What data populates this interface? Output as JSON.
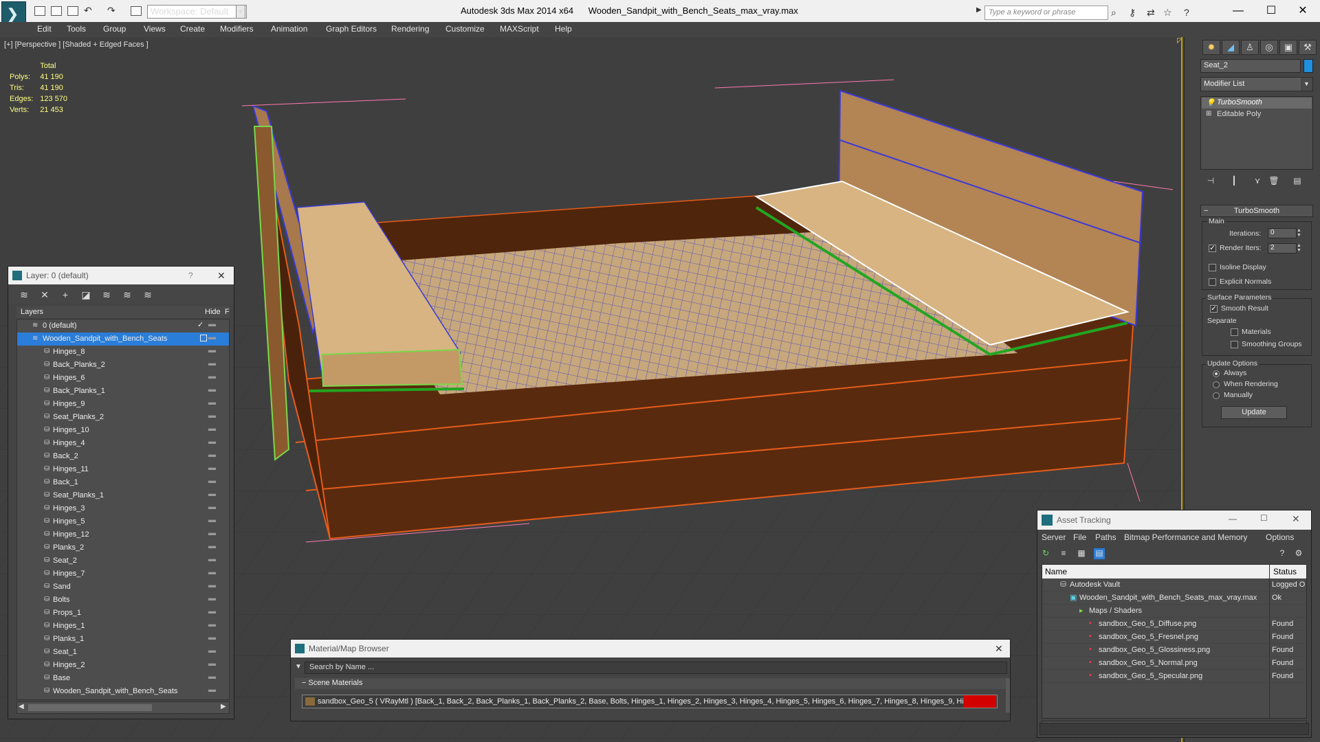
{
  "window": {
    "app_title": "Autodesk 3ds Max  2014 x64",
    "file_title": "Wooden_Sandpit_with_Bench_Seats_max_vray.max",
    "workspace": "Workspace: Default",
    "search_placeholder": "Type a keyword or phrase"
  },
  "menu": [
    "Edit",
    "Tools",
    "Group",
    "Views",
    "Create",
    "Modifiers",
    "Animation",
    "Graph Editors",
    "Rendering",
    "Customize",
    "MAXScript",
    "Help"
  ],
  "viewport": {
    "label": "[+] [Perspective ] [Shaded + Edged Faces ]",
    "stats": {
      "header": "Total",
      "rows": [
        {
          "label": "Polys:",
          "value": "41 190"
        },
        {
          "label": "Tris:",
          "value": "41 190"
        },
        {
          "label": "Edges:",
          "value": "123 570"
        },
        {
          "label": "Verts:",
          "value": "21 453"
        }
      ]
    }
  },
  "command_panel": {
    "object_name": "Seat_2",
    "object_color": "#1f8fdf",
    "modifier_list": "Modifier List",
    "stack": [
      "TurboSmooth",
      "Editable Poly"
    ],
    "turbosmooth": {
      "title": "TurboSmooth",
      "main_label": "Main",
      "iterations_label": "Iterations:",
      "iterations_value": "0",
      "render_iters_label": "Render Iters:",
      "render_iters_value": "2",
      "isoline_label": "Isoline Display",
      "explicit_normals_label": "Explicit Normals",
      "surface_params_label": "Surface Parameters",
      "smooth_result_label": "Smooth Result",
      "separate_label": "Separate",
      "materials_label": "Materials",
      "smoothing_groups_label": "Smoothing Groups",
      "update_options_label": "Update Options",
      "always_label": "Always",
      "when_rendering_label": "When Rendering",
      "manually_label": "Manually",
      "update_button": "Update"
    }
  },
  "layers_panel": {
    "title": "Layer: 0 (default)",
    "col_layers": "Layers",
    "col_hide": "Hide",
    "col_f": "F",
    "rows": [
      {
        "name": "0 (default)",
        "level": 0,
        "selected": false
      },
      {
        "name": "Wooden_Sandpit_with_Bench_Seats",
        "level": 0,
        "selected": true
      },
      {
        "name": "Hinges_8",
        "level": 1
      },
      {
        "name": "Back_Planks_2",
        "level": 1
      },
      {
        "name": "Hinges_6",
        "level": 1
      },
      {
        "name": "Back_Planks_1",
        "level": 1
      },
      {
        "name": "Hinges_9",
        "level": 1
      },
      {
        "name": "Seat_Planks_2",
        "level": 1
      },
      {
        "name": "Hinges_10",
        "level": 1
      },
      {
        "name": "Hinges_4",
        "level": 1
      },
      {
        "name": "Back_2",
        "level": 1
      },
      {
        "name": "Hinges_11",
        "level": 1
      },
      {
        "name": "Back_1",
        "level": 1
      },
      {
        "name": "Seat_Planks_1",
        "level": 1
      },
      {
        "name": "Hinges_3",
        "level": 1
      },
      {
        "name": "Hinges_5",
        "level": 1
      },
      {
        "name": "Hinges_12",
        "level": 1
      },
      {
        "name": "Planks_2",
        "level": 1
      },
      {
        "name": "Seat_2",
        "level": 1
      },
      {
        "name": "Hinges_7",
        "level": 1
      },
      {
        "name": "Sand",
        "level": 1
      },
      {
        "name": "Bolts",
        "level": 1
      },
      {
        "name": "Props_1",
        "level": 1
      },
      {
        "name": "Hinges_1",
        "level": 1
      },
      {
        "name": "Planks_1",
        "level": 1
      },
      {
        "name": "Seat_1",
        "level": 1
      },
      {
        "name": "Hinges_2",
        "level": 1
      },
      {
        "name": "Base",
        "level": 1
      },
      {
        "name": "Wooden_Sandpit_with_Bench_Seats",
        "level": 1
      }
    ]
  },
  "material_browser": {
    "title": "Material/Map Browser",
    "search_placeholder": "Search by Name ...",
    "section": "Scene Materials",
    "material_row": "sandbox_Geo_5  ( VRayMtl ) [Back_1, Back_2, Back_Planks_1, Back_Planks_2, Base, Bolts, Hinges_1, Hinges_2, Hinges_3, Hinges_4, Hinges_5, Hinges_6, Hinges_7, Hinges_8, Hinges_9, Hinges..."
  },
  "asset_tracking": {
    "title": "Asset Tracking",
    "menu": [
      "Server",
      "File",
      "Paths",
      "Bitmap Performance and Memory",
      "Options"
    ],
    "col_name": "Name",
    "col_status": "Status",
    "rows": [
      {
        "name": "Autodesk Vault",
        "status": "Logged O",
        "indent": 1,
        "icon": "vault-icon"
      },
      {
        "name": "Wooden_Sandpit_with_Bench_Seats_max_vray.max",
        "status": "Ok",
        "indent": 2,
        "icon": "max-file-icon"
      },
      {
        "name": "Maps / Shaders",
        "status": "",
        "indent": 3,
        "icon": "folder-icon"
      },
      {
        "name": "sandbox_Geo_5_Diffuse.png",
        "status": "Found",
        "indent": 4,
        "icon": "png-icon"
      },
      {
        "name": "sandbox_Geo_5_Fresnel.png",
        "status": "Found",
        "indent": 4,
        "icon": "png-icon"
      },
      {
        "name": "sandbox_Geo_5_Glossiness.png",
        "status": "Found",
        "indent": 4,
        "icon": "png-icon"
      },
      {
        "name": "sandbox_Geo_5_Normal.png",
        "status": "Found",
        "indent": 4,
        "icon": "png-icon"
      },
      {
        "name": "sandbox_Geo_5_Specular.png",
        "status": "Found",
        "indent": 4,
        "icon": "png-icon"
      }
    ]
  }
}
